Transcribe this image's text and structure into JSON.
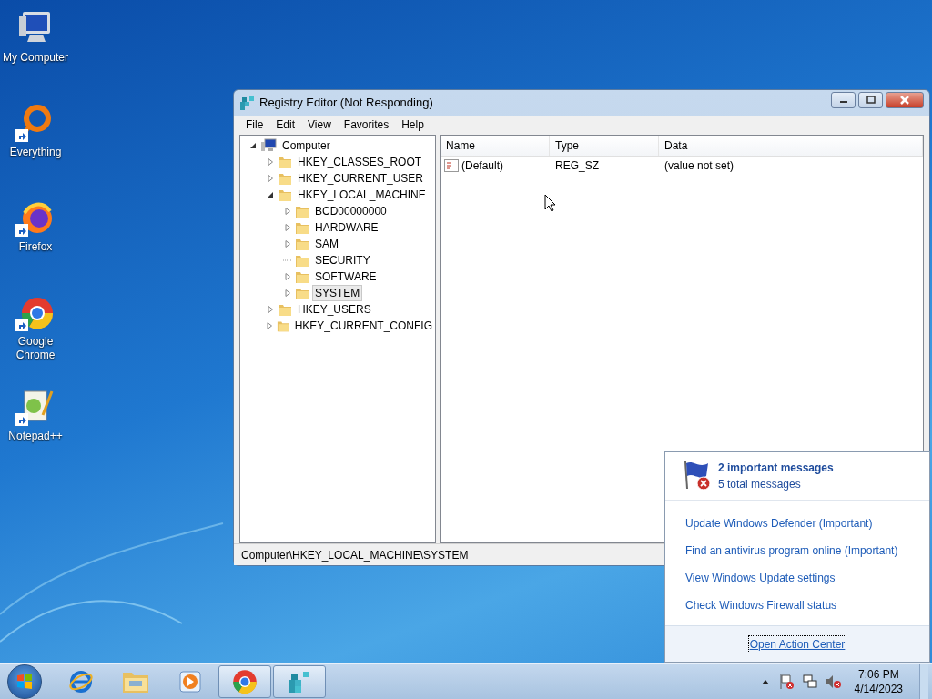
{
  "desktop_icons": [
    {
      "label": "My Computer",
      "shortcut": false
    },
    {
      "label": "Everything",
      "shortcut": true
    },
    {
      "label": "Firefox",
      "shortcut": true
    },
    {
      "label": "Google Chrome",
      "shortcut": true
    },
    {
      "label": "Notepad++",
      "shortcut": true
    }
  ],
  "window": {
    "title": "Registry Editor (Not Responding)",
    "menu": [
      "File",
      "Edit",
      "View",
      "Favorites",
      "Help"
    ],
    "tree": [
      {
        "label": "Computer",
        "expandable": true,
        "expanded": true,
        "selected": false,
        "children": [
          {
            "label": "HKEY_CLASSES_ROOT",
            "expandable": true,
            "expanded": false,
            "selected": false
          },
          {
            "label": "HKEY_CURRENT_USER",
            "expandable": true,
            "expanded": false,
            "selected": false
          },
          {
            "label": "HKEY_LOCAL_MACHINE",
            "expandable": true,
            "expanded": true,
            "selected": false,
            "children": [
              {
                "label": "BCD00000000",
                "expandable": true,
                "expanded": false,
                "selected": false
              },
              {
                "label": "HARDWARE",
                "expandable": true,
                "expanded": false,
                "selected": false
              },
              {
                "label": "SAM",
                "expandable": true,
                "expanded": false,
                "selected": false
              },
              {
                "label": "SECURITY",
                "expandable": false,
                "selected": false
              },
              {
                "label": "SOFTWARE",
                "expandable": true,
                "expanded": false,
                "selected": false
              },
              {
                "label": "SYSTEM",
                "expandable": true,
                "expanded": false,
                "selected": true
              }
            ]
          },
          {
            "label": "HKEY_USERS",
            "expandable": true,
            "expanded": false,
            "selected": false
          },
          {
            "label": "HKEY_CURRENT_CONFIG",
            "expandable": true,
            "expanded": false,
            "selected": false
          }
        ]
      }
    ],
    "columns": [
      "Name",
      "Type",
      "Data"
    ],
    "rows": [
      {
        "name": "(Default)",
        "type": "REG_SZ",
        "data": "(value not set)"
      }
    ],
    "status_bar": "Computer\\HKEY_LOCAL_MACHINE\\SYSTEM"
  },
  "action_center": {
    "title": "2 important messages",
    "subtitle": "5 total messages",
    "links": [
      "Update Windows Defender (Important)",
      "Find an antivirus program online (Important)",
      "View Windows Update settings",
      "Check Windows Firewall status"
    ],
    "footer_link": "Open Action Center"
  },
  "taskbar": {
    "buttons": [
      {
        "running": false
      },
      {
        "running": false
      },
      {
        "running": false
      },
      {
        "running": true
      },
      {
        "running": true
      }
    ],
    "time": "7:06 PM",
    "date": "4/14/2023"
  }
}
